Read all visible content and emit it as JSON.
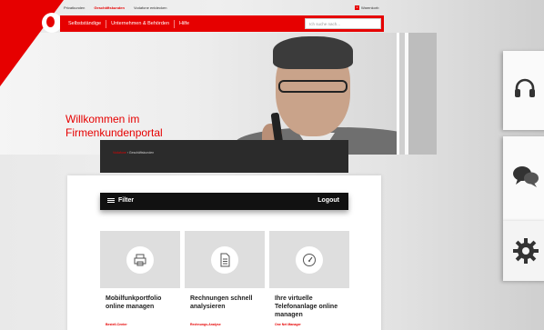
{
  "topnav": {
    "items": [
      "Privatkunden",
      "Geschäftskunden",
      "Vodafone entdecken"
    ],
    "right_label": "Warenkorb",
    "cart_count": "1"
  },
  "mainnav": {
    "items": [
      "Selbstständige",
      "Unternehmen & Behörden",
      "Hilfe"
    ],
    "search_placeholder": "Ich suche nach..."
  },
  "hero": {
    "title_line1": "Willkommen im",
    "title_line2": "Firmenkundenportal"
  },
  "breadcrumb": {
    "first": "Vodafone",
    "second": "Geschäftskunden"
  },
  "toolbar": {
    "filter_label": "Filter",
    "logout_label": "Logout"
  },
  "tiles": [
    {
      "title": "Mobilfunkportfolio online managen",
      "link": "Bestell-Center",
      "icon": "printer-icon"
    },
    {
      "title": "Rechnungen schnell analysieren",
      "link": "Rechnungs-Analyse",
      "icon": "invoice-icon"
    },
    {
      "title": "Ihre virtuelle Telefonanlage online managen",
      "link": "One Net Manager",
      "icon": "dashboard-gauge-icon"
    }
  ],
  "side_icons": [
    "headset-icon",
    "chat-bubbles-icon",
    "gear-icon"
  ],
  "colors": {
    "brand_red": "#e60000",
    "dark": "#2b2b2b",
    "tile_gray": "#dedede"
  }
}
